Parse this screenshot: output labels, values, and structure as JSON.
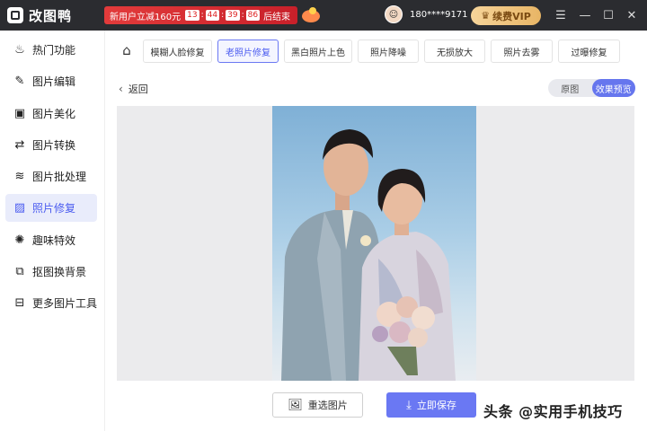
{
  "app": {
    "title": "改图鸭"
  },
  "promo": {
    "text": "新用户立减160元",
    "timer": [
      "13",
      "44",
      "39",
      "86"
    ],
    "ends": "后结束"
  },
  "user": {
    "phone": "180****9171"
  },
  "vip": {
    "label": "续费VIP"
  },
  "window_controls": {
    "menu": "☰",
    "minimize": "—",
    "maximize": "☐",
    "close": "✕"
  },
  "sidebar": {
    "items": [
      {
        "label": "热门功能",
        "icon": "fire-icon",
        "glyph": "♨",
        "active": false
      },
      {
        "label": "图片编辑",
        "icon": "image-edit-icon",
        "glyph": "✎",
        "active": false
      },
      {
        "label": "图片美化",
        "icon": "image-beautify-icon",
        "glyph": "▣",
        "active": false
      },
      {
        "label": "图片转换",
        "icon": "convert-icon",
        "glyph": "⇄",
        "active": false
      },
      {
        "label": "图片批处理",
        "icon": "batch-icon",
        "glyph": "≋",
        "active": false
      },
      {
        "label": "照片修复",
        "icon": "photo-repair-icon",
        "glyph": "▨",
        "active": true
      },
      {
        "label": "趣味特效",
        "icon": "effects-icon",
        "glyph": "✺",
        "active": false
      },
      {
        "label": "抠图换背景",
        "icon": "cutout-icon",
        "glyph": "⧉",
        "active": false
      },
      {
        "label": "更多图片工具",
        "icon": "toolbox-icon",
        "glyph": "⊟",
        "active": false
      }
    ]
  },
  "tabs": [
    {
      "label": "模糊人脸修复",
      "active": false
    },
    {
      "label": "老照片修复",
      "active": true
    },
    {
      "label": "黑白照片上色",
      "active": false
    },
    {
      "label": "照片降噪",
      "active": false
    },
    {
      "label": "无损放大",
      "active": false
    },
    {
      "label": "照片去雾",
      "active": false
    },
    {
      "label": "过曝修复",
      "active": false
    }
  ],
  "back": {
    "label": "返回"
  },
  "view_toggle": {
    "original": "原图",
    "preview": "效果预览",
    "selected": "效果预览"
  },
  "buttons": {
    "reselect": "重选图片",
    "save": "立即保存"
  },
  "watermark": "头条 @实用手机技巧",
  "colors": {
    "accent": "#6a78f3",
    "titlebar": "#2b2c30",
    "promo": "#d6262e",
    "vip": "#e8b565"
  }
}
